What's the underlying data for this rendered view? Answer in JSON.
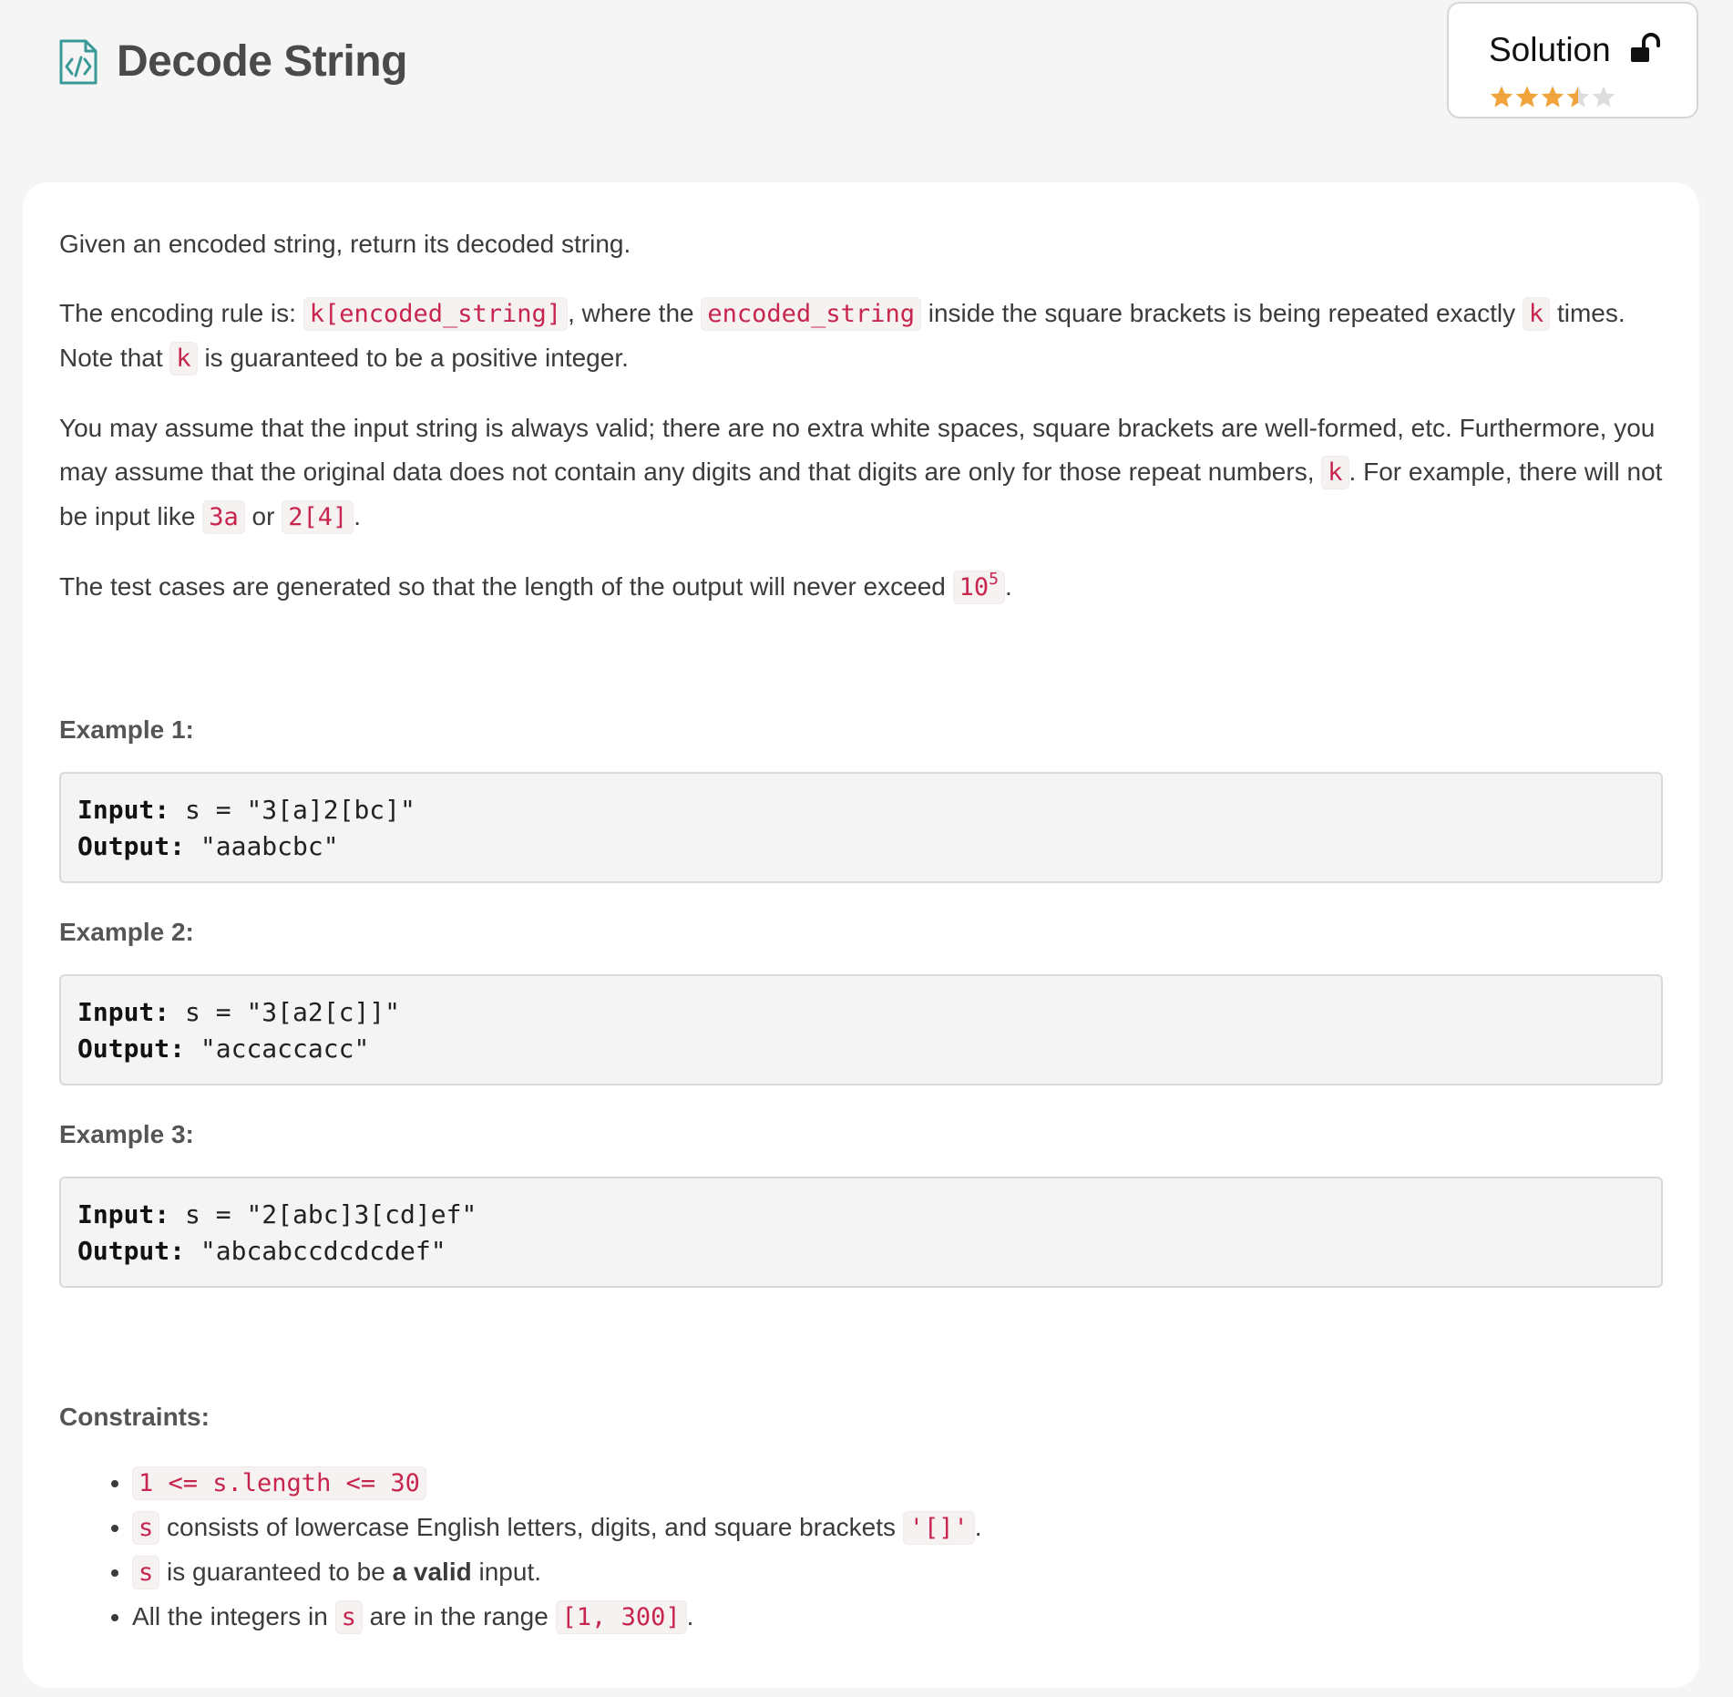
{
  "header": {
    "title": "Decode String",
    "solution_label": "Solution",
    "rating": 3.5,
    "rating_max": 5,
    "star_color": "#f0a43b",
    "star_empty_color": "#dddddd",
    "icon_color": "#3a9a98"
  },
  "description": {
    "p1": "Given an encoded string, return its decoded string.",
    "p2": {
      "t1": "The encoding rule is: ",
      "c1": "k[encoded_string]",
      "t2": ", where the ",
      "c2": "encoded_string",
      "t3": " inside the square brackets is being repeated exactly ",
      "c3": "k",
      "t4": " times. Note that ",
      "c4": "k",
      "t5": " is guaranteed to be a positive integer."
    },
    "p3": {
      "t1": "You may assume that the input string is always valid; there are no extra white spaces, square brackets are well-formed, etc. Furthermore, you may assume that the original data does not contain any digits and that digits are only for those repeat numbers, ",
      "c1": "k",
      "t2": ". For example, there will not be input like ",
      "c2": "3a",
      "t3": " or ",
      "c3": "2[4]",
      "t4": "."
    },
    "p4": {
      "t1": "The test cases are generated so that the length of the output will never exceed ",
      "c1_base": "10",
      "c1_exp": "5",
      "t2": "."
    }
  },
  "examples": [
    {
      "title": "Example 1:",
      "input_label": "Input:",
      "input": " s = \"3[a]2[bc]\"",
      "output_label": "Output:",
      "output": " \"aaabcbc\""
    },
    {
      "title": "Example 2:",
      "input_label": "Input:",
      "input": " s = \"3[a2[c]]\"",
      "output_label": "Output:",
      "output": " \"accaccacc\""
    },
    {
      "title": "Example 3:",
      "input_label": "Input:",
      "input": " s = \"2[abc]3[cd]ef\"",
      "output_label": "Output:",
      "output": " \"abcabccdcdcdef\""
    }
  ],
  "constraints": {
    "title": "Constraints:",
    "c1": "1 <= s.length <= 30",
    "c2": {
      "code": "s",
      "t1": " consists of lowercase English letters, digits, and square brackets ",
      "code2": "'[]'",
      "t2": "."
    },
    "c3": {
      "code": "s",
      "t1": " is guaranteed to be ",
      "bold": "a valid",
      "t2": " input."
    },
    "c4": {
      "t1": "All the integers in ",
      "code": "s",
      "t2": " are in the range ",
      "code2": "[1, 300]",
      "t3": "."
    }
  }
}
